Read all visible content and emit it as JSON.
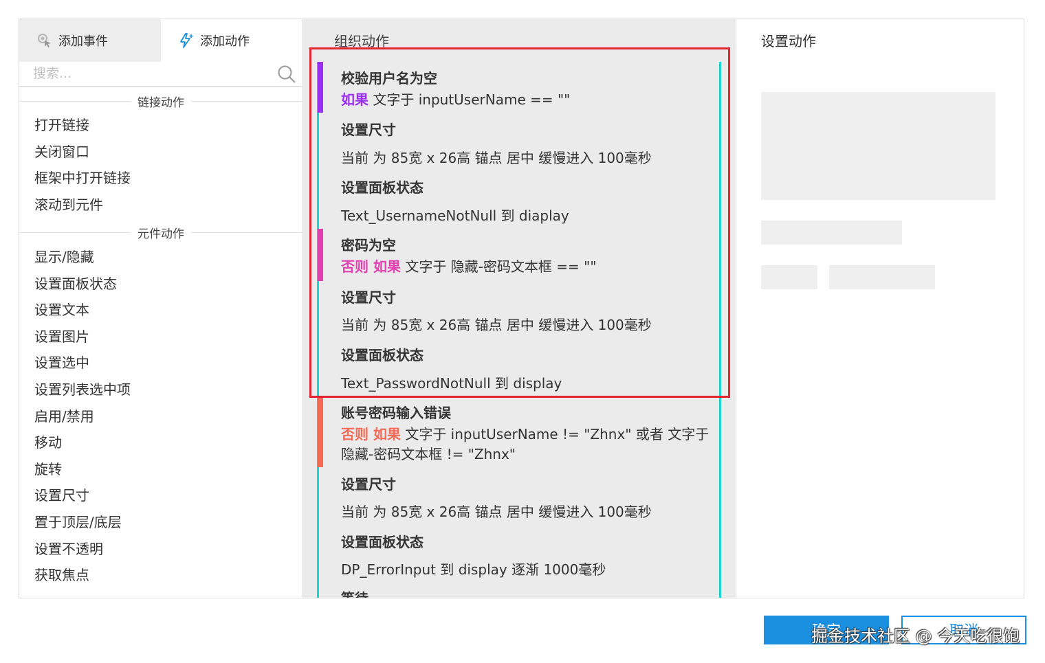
{
  "tabs": {
    "add_event": "添加事件",
    "add_action": "添加动作"
  },
  "search": {
    "placeholder": "搜索..."
  },
  "left": {
    "section_link": "链接动作",
    "link_actions": [
      "打开链接",
      "关闭窗口",
      "框架中打开链接",
      "滚动到元件"
    ],
    "section_widget": "元件动作",
    "widget_actions": [
      "显示/隐藏",
      "设置面板状态",
      "设置文本",
      "设置图片",
      "设置选中",
      "设置列表选中项",
      "启用/禁用",
      "移动",
      "旋转",
      "设置尺寸",
      "置于顶层/底层",
      "设置不透明",
      "获取焦点"
    ]
  },
  "middle": {
    "title": "组织动作",
    "cases": [
      {
        "name": "校验用户名为空",
        "cond_keywords": "如果",
        "cond_text": "文字于 inputUserName == \"\"",
        "color": "#9b30f0",
        "kw_color": "#9b30f0",
        "actions": [
          {
            "name": "设置尺寸",
            "detail": "当前 为 85宽 x 26高  锚点 居中 缓慢进入 100毫秒"
          },
          {
            "name": "设置面板状态",
            "detail": "Text_UsernameNotNull 到 diaplay"
          }
        ]
      },
      {
        "name": "密码为空",
        "cond_keywords": "否则 如果",
        "cond_text": "文字于 隐藏-密码文本框 == \"\"",
        "color": "#e040b0",
        "kw_color": "#e040b0",
        "actions": [
          {
            "name": "设置尺寸",
            "detail": "当前 为 85宽 x 26高  锚点 居中 缓慢进入 100毫秒"
          },
          {
            "name": "设置面板状态",
            "detail": "Text_PasswordNotNull 到 display"
          }
        ]
      },
      {
        "name": "账号密码输入错误",
        "cond_keywords": "否则 如果",
        "cond_text": "文字于 inputUserName != \"Zhnx\" 或者 文字于",
        "cond_text_2": "隐藏-密码文本框 != \"Zhnx\"",
        "color": "#f46a55",
        "kw_color": "#f46a55",
        "actions": [
          {
            "name": "设置尺寸",
            "detail": "当前 为 85宽 x 26高  锚点 居中 缓慢进入 100毫秒"
          },
          {
            "name": "设置面板状态",
            "detail": "DP_ErrorInput 到 display 逐渐 1000毫秒"
          }
        ]
      }
    ],
    "truncated_next": "等待"
  },
  "right": {
    "title": "设置动作"
  },
  "buttons": {
    "ok": "确定",
    "cancel": "取消"
  },
  "watermark": "掘金技术社区 @ 今天吃很饱",
  "colors": {
    "accent": "#1a8fe0",
    "case_line": "#19d6d0",
    "highlight": "#e02430"
  }
}
